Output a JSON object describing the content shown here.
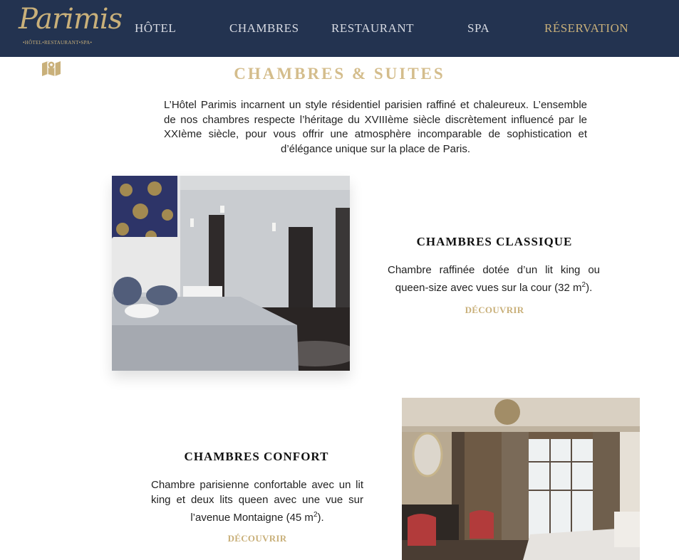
{
  "logo": {
    "script": "Parimis",
    "subtitle": "•HÔTEL•RESTAURANT•SPA•"
  },
  "nav": {
    "hotel": "HÔTEL",
    "chambres": "CHAMBRES",
    "restaurant": "RESTAURANT",
    "spa": "SPA",
    "reservation": "RÉSERVATION"
  },
  "section": {
    "title": "CHAMBRES & SUITES",
    "intro": "L’Hôtel Parimis incarnent un style résidentiel parisien raffiné et chaleureux. L’ensemble de nos chambres respecte l’héritage du XVIIIème siècle discrètement influencé par le XXIème siècle, pour vous offrir une atmosphère incomparable de sophistication et d’élégance unique sur la place de Paris."
  },
  "rooms": [
    {
      "title": "CHAMBRES CLASSIQUE",
      "desc": "Chambre raffinée dotée d’un lit king ou queen-size avec vues sur la cour (32 m",
      "sup": "2",
      "desc_end": ").",
      "link": "DÉCOUVRIR"
    },
    {
      "title": "CHAMBRES CONFORT",
      "desc": "Chambre parisienne confortable avec un lit king et deux lits queen avec une vue sur l’avenue Montaigne (45 m",
      "sup": "2",
      "desc_end": ").",
      "link": "DÉCOUVRIR"
    }
  ],
  "colors": {
    "header_bg": "#233350",
    "gold": "#c9b07a",
    "title_gold": "#d4bd8c"
  }
}
